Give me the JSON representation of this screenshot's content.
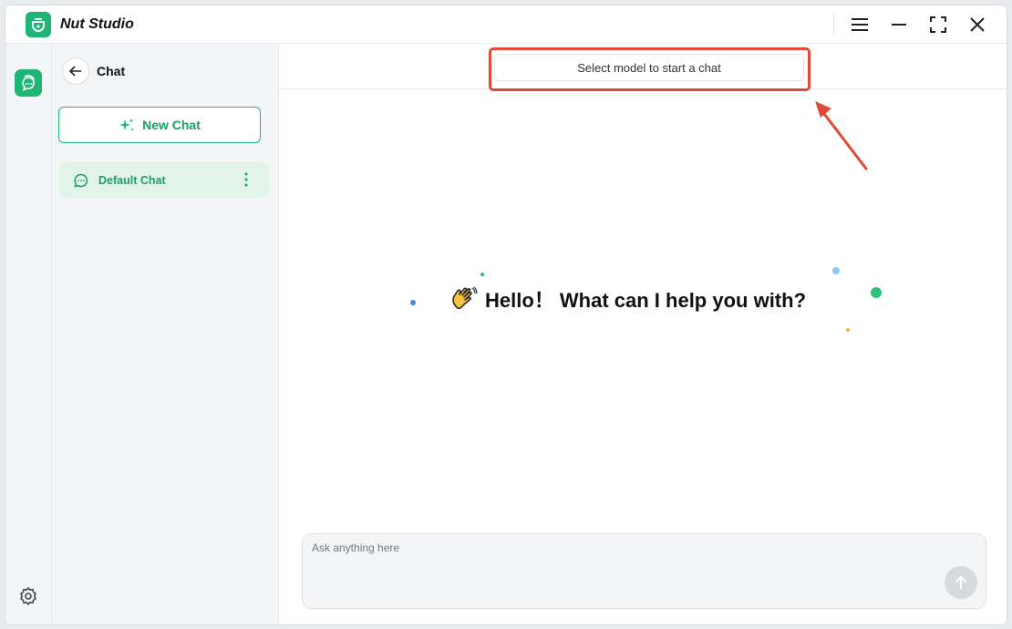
{
  "app": {
    "title": "Nut Studio"
  },
  "titlebar": {
    "icons": [
      "menu-icon",
      "minimize-icon",
      "fullscreen-icon",
      "close-icon"
    ]
  },
  "rail": {
    "items": [
      "chat-icon"
    ],
    "footer": [
      "gear-icon"
    ]
  },
  "sidebar": {
    "title": "Chat",
    "new_chat_label": "New Chat",
    "chats": [
      {
        "label": "Default Chat",
        "active": true
      }
    ]
  },
  "main": {
    "model_select_label": "Select model to start a chat",
    "greeting": "Hello！ What can I help you with?",
    "greeting_icon": "waving-hand-icon",
    "composer": {
      "placeholder": "Ask anything here",
      "value": ""
    }
  },
  "colors": {
    "accent": "#1fb574",
    "accent_text": "#1a9f63",
    "annotation": "#e04a36"
  }
}
